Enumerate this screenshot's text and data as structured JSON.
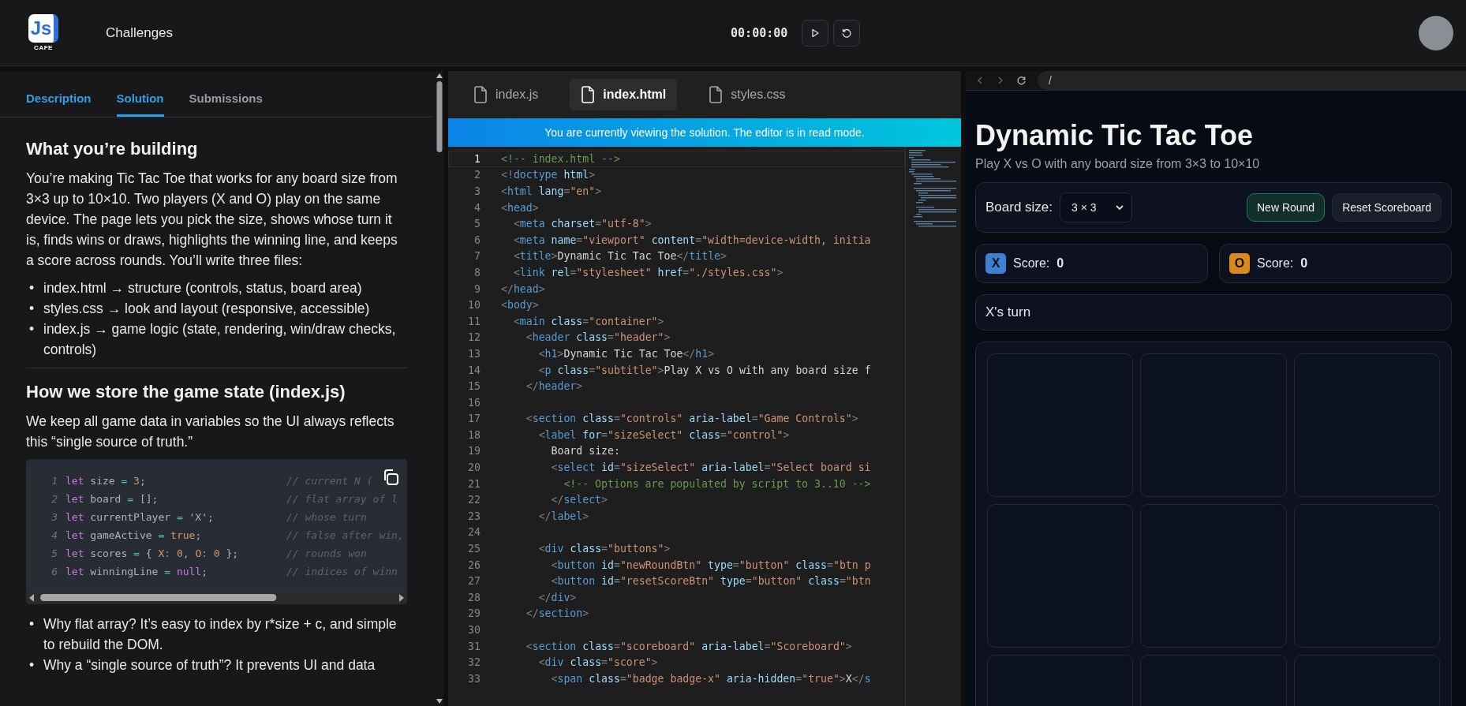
{
  "header": {
    "logo": {
      "mark": "Js",
      "caption": "CAFE"
    },
    "nav": "Challenges",
    "timer": "00:00:00"
  },
  "left_panel": {
    "tabs": [
      {
        "label": "Description",
        "selected": false,
        "accent": true
      },
      {
        "label": "Solution",
        "selected": true,
        "accent": true
      },
      {
        "label": "Submissions",
        "selected": false,
        "accent": false
      }
    ],
    "sections": [
      {
        "heading": "What you’re building",
        "paragraph": "You’re making Tic Tac Toe that works for any board size from 3×3 up to 10×10. Two players (X and O) play on the same device. The page lets you pick the size, shows whose turn it is, finds wins or draws, highlights the winning line, and keeps a score across rounds. You’ll write three files:",
        "bullets": [
          {
            "marker": "•",
            "text": "index.html → structure (controls, status, board area)"
          },
          {
            "marker": "•",
            "text": "styles.css → look and layout (responsive, accessible)"
          },
          {
            "marker": "•",
            "text": "index.js → game logic (state, rendering, win/draw checks, controls)"
          }
        ]
      },
      {
        "heading": "How we store the game state (index.js)",
        "paragraph": "We keep all game data in variables so the UI always reflects this “single source of truth.”",
        "code_block": {
          "lines": [
            {
              "n": "1",
              "tokens": [
                {
                  "kind": "keyword",
                  "t": "let"
                },
                {
                  "kind": "name",
                  "t": " size "
                },
                {
                  "kind": "operator",
                  "t": "="
                },
                {
                  "kind": "number",
                  "t": " 3"
                },
                {
                  "kind": "name",
                  "t": ";"
                }
              ],
              "comment": "// current N ("
            },
            {
              "n": "2",
              "tokens": [
                {
                  "kind": "keyword",
                  "t": "let"
                },
                {
                  "kind": "name",
                  "t": " board "
                },
                {
                  "kind": "operator",
                  "t": "="
                },
                {
                  "kind": "name",
                  "t": " [];"
                }
              ],
              "comment": "// flat array of l"
            },
            {
              "n": "3",
              "tokens": [
                {
                  "kind": "keyword",
                  "t": "let"
                },
                {
                  "kind": "name",
                  "t": " currentPlayer "
                },
                {
                  "kind": "operator",
                  "t": "="
                },
                {
                  "kind": "string",
                  "t": " 'X'"
                },
                {
                  "kind": "name",
                  "t": ";"
                }
              ],
              "comment": "// whose turn"
            },
            {
              "n": "4",
              "tokens": [
                {
                  "kind": "keyword",
                  "t": "let"
                },
                {
                  "kind": "name",
                  "t": " gameActive "
                },
                {
                  "kind": "operator",
                  "t": "="
                },
                {
                  "kind": "boolean",
                  "t": " true"
                },
                {
                  "kind": "name",
                  "t": ";"
                }
              ],
              "comment": "// false after win,"
            },
            {
              "n": "5",
              "tokens": [
                {
                  "kind": "keyword",
                  "t": "let"
                },
                {
                  "kind": "name",
                  "t": " scores "
                },
                {
                  "kind": "operator",
                  "t": "="
                },
                {
                  "kind": "name",
                  "t": " { "
                },
                {
                  "kind": "number",
                  "t": "X"
                },
                {
                  "kind": "operator",
                  "t": ":"
                },
                {
                  "kind": "number",
                  "t": " 0"
                },
                {
                  "kind": "name",
                  "t": ", "
                },
                {
                  "kind": "number",
                  "t": "O"
                },
                {
                  "kind": "operator",
                  "t": ":"
                },
                {
                  "kind": "number",
                  "t": " 0"
                },
                {
                  "kind": "name",
                  "t": " };"
                }
              ],
              "comment": "// rounds won"
            },
            {
              "n": "6",
              "tokens": [
                {
                  "kind": "keyword",
                  "t": "let"
                },
                {
                  "kind": "name",
                  "t": " winningLine "
                },
                {
                  "kind": "operator",
                  "t": "="
                },
                {
                  "kind": "null",
                  "t": " null"
                },
                {
                  "kind": "name",
                  "t": ";"
                }
              ],
              "comment": "// indices of winn"
            }
          ]
        },
        "bullets": [
          {
            "marker": "•",
            "text": "Why flat array? It’s easy to index by r*size + c, and simple to rebuild the DOM."
          },
          {
            "marker": "•",
            "text": "Why a “single source of truth”? It prevents UI and data"
          }
        ]
      }
    ]
  },
  "editor": {
    "tabs": [
      {
        "label": "index.js",
        "selected": false
      },
      {
        "label": "index.html",
        "selected": true
      },
      {
        "label": "styles.css",
        "selected": false
      }
    ],
    "banner": "You are currently viewing the solution. The editor is in read mode.",
    "lines": [
      {
        "n": "1",
        "code": "<!-- index.html -->",
        "current": true
      },
      {
        "n": "2",
        "code": "<!doctype html>",
        "current": false
      },
      {
        "n": "3",
        "code": "<html lang=\"en\">",
        "current": false
      },
      {
        "n": "4",
        "code": "<head>",
        "current": false
      },
      {
        "n": "5",
        "code": "  <meta charset=\"utf-8\">",
        "current": false
      },
      {
        "n": "6",
        "code": "  <meta name=\"viewport\" content=\"width=device-width, initia",
        "current": false
      },
      {
        "n": "7",
        "code": "  <title>Dynamic Tic Tac Toe</title>",
        "current": false
      },
      {
        "n": "8",
        "code": "  <link rel=\"stylesheet\" href=\"./styles.css\">",
        "current": false
      },
      {
        "n": "9",
        "code": "</head>",
        "current": false
      },
      {
        "n": "10",
        "code": "<body>",
        "current": false
      },
      {
        "n": "11",
        "code": "  <main class=\"container\">",
        "current": false
      },
      {
        "n": "12",
        "code": "    <header class=\"header\">",
        "current": false
      },
      {
        "n": "13",
        "code": "      <h1>Dynamic Tic Tac Toe</h1>",
        "current": false
      },
      {
        "n": "14",
        "code": "      <p class=\"subtitle\">Play X vs O with any board size f",
        "current": false
      },
      {
        "n": "15",
        "code": "    </header>",
        "current": false
      },
      {
        "n": "16",
        "current": false
      },
      {
        "n": "17",
        "code": "    <section class=\"controls\" aria-label=\"Game Controls\">",
        "current": false
      },
      {
        "n": "18",
        "code": "      <label for=\"sizeSelect\" class=\"control\">",
        "current": false
      },
      {
        "n": "19",
        "code": "        Board size:",
        "current": false
      },
      {
        "n": "20",
        "code": "        <select id=\"sizeSelect\" aria-label=\"Select board si",
        "current": false
      },
      {
        "n": "21",
        "code": "          <!-- Options are populated by script to 3..10 -->",
        "current": false
      },
      {
        "n": "22",
        "code": "        </select>",
        "current": false
      },
      {
        "n": "23",
        "code": "      </label>",
        "current": false
      },
      {
        "n": "24",
        "current": false
      },
      {
        "n": "25",
        "code": "      <div class=\"buttons\">",
        "current": false
      },
      {
        "n": "26",
        "code": "        <button id=\"newRoundBtn\" type=\"button\" class=\"btn p",
        "current": false
      },
      {
        "n": "27",
        "code": "        <button id=\"resetScoreBtn\" type=\"button\" class=\"btn",
        "current": false
      },
      {
        "n": "28",
        "code": "      </div>",
        "current": false
      },
      {
        "n": "29",
        "code": "    </section>",
        "current": false
      },
      {
        "n": "30",
        "current": false
      },
      {
        "n": "31",
        "code": "    <section class=\"scoreboard\" aria-label=\"Scoreboard\">",
        "current": false
      },
      {
        "n": "32",
        "code": "      <div class=\"score\">",
        "current": false
      },
      {
        "n": "33",
        "code": "        <span class=\"badge badge-x\" aria-hidden=\"true\">X</s",
        "current": false
      }
    ]
  },
  "preview": {
    "address": "/",
    "title": "Dynamic Tic Tac Toe",
    "subtitle": "Play X vs O with any board size from 3×3 to 10×10",
    "controls": {
      "label": "Board size:",
      "select_value": "3 × 3",
      "buttons": [
        {
          "label": "New Round",
          "kind": "primary"
        },
        {
          "label": "Reset Scoreboard",
          "kind": "secondary"
        }
      ]
    },
    "scores": [
      {
        "badge": "X",
        "label": "Score:",
        "value": "0",
        "color": "#3f7fd0"
      },
      {
        "badge": "O",
        "label": "Score:",
        "value": "0",
        "color": "#d98a1c"
      }
    ],
    "status": "X's turn",
    "cells": [
      {
        "filled": false
      },
      {
        "filled": false
      },
      {
        "filled": false
      },
      {
        "filled": false
      },
      {
        "filled": false
      },
      {
        "filled": false
      },
      {
        "filled": false
      },
      {
        "filled": false
      },
      {
        "filled": false
      }
    ]
  }
}
